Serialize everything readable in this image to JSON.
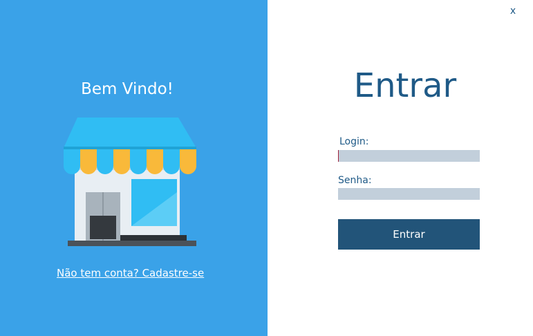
{
  "window": {
    "close_label": "x"
  },
  "left_panel": {
    "welcome_text": "Bem Vindo!",
    "illustration": "storefront-icon",
    "signup_link": "Não tem conta? Cadastre-se",
    "background_color": "#3aa2e8"
  },
  "login_form": {
    "title": "Entrar",
    "login_label": "Login:",
    "login_value": "",
    "password_label": "Senha:",
    "password_value": "",
    "submit_label": "Entrar",
    "accent_color": "#225479",
    "input_color": "#c2cfdb"
  }
}
